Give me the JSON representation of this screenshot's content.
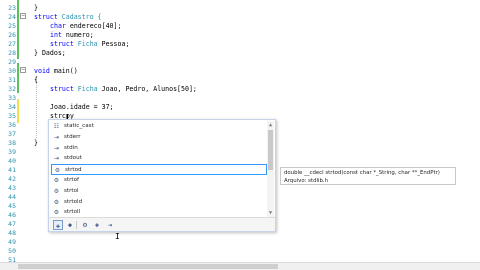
{
  "editor": {
    "line_numbers": [
      "23",
      "24",
      "25",
      "26",
      "27",
      "28",
      "29",
      "30",
      "31",
      "32",
      "33",
      "34",
      "35",
      "36",
      "37",
      "38",
      "39",
      "40",
      "41",
      "42",
      "43",
      "44",
      "45",
      "46",
      "47",
      "48",
      "49",
      "50",
      "51"
    ],
    "code": {
      "l23": "}",
      "l24_kw": "struct",
      "l24_name": " Cadastro {",
      "l25_kw": "char",
      "l25_rest": " endereco[40];",
      "l26_kw": "int",
      "l26_rest": " numero;",
      "l27_kw": "struct",
      "l27_ty": " Ficha",
      "l27_rest": " Pessoa;",
      "l28": "} Dados;",
      "l30_kw": "void",
      "l30_rest": " main()",
      "l31": "{",
      "l32_kw": "struct",
      "l32_ty": " Ficha",
      "l32_rest": " Joao, Pedro, Alunos[50];",
      "l34": "Joao.idade = 37;",
      "l35": "strcpy",
      "l37": "}"
    }
  },
  "autocomplete": {
    "items": [
      {
        "label": "static_cast",
        "icon": "keyword-icon",
        "glyph": "☷"
      },
      {
        "label": "stderr",
        "icon": "macro-icon",
        "glyph": "⇥"
      },
      {
        "label": "stdin",
        "icon": "macro-icon",
        "glyph": "⇥"
      },
      {
        "label": "stdout",
        "icon": "macro-icon",
        "glyph": "⇥"
      },
      {
        "label": "strtod",
        "icon": "function-icon",
        "glyph": "⚙"
      },
      {
        "label": "strtof",
        "icon": "function-icon",
        "glyph": "⚙"
      },
      {
        "label": "strtol",
        "icon": "function-icon",
        "glyph": "⚙"
      },
      {
        "label": "strtold",
        "icon": "function-icon",
        "glyph": "⚙"
      },
      {
        "label": "strtoll",
        "icon": "function-icon",
        "glyph": "⚙"
      }
    ],
    "selected_index": 4,
    "filters": [
      {
        "name": "all-filter-icon",
        "glyph": "✚"
      },
      {
        "name": "class-filter-icon",
        "glyph": "◆"
      },
      {
        "name": "function-filter-icon",
        "glyph": "⚙"
      },
      {
        "name": "member-filter-icon",
        "glyph": "◈"
      },
      {
        "name": "macro-filter-icon",
        "glyph": "⇥"
      }
    ]
  },
  "tooltip": {
    "signature": "double __cdecl strtod(const char *_String, char **_EndPtr)",
    "file": "Arquivo: stdlib.h"
  },
  "colors": {
    "keyword": "#0000ff",
    "type": "#2b91af",
    "line_number": "#2b91af",
    "selection_border": "#3399ff"
  }
}
